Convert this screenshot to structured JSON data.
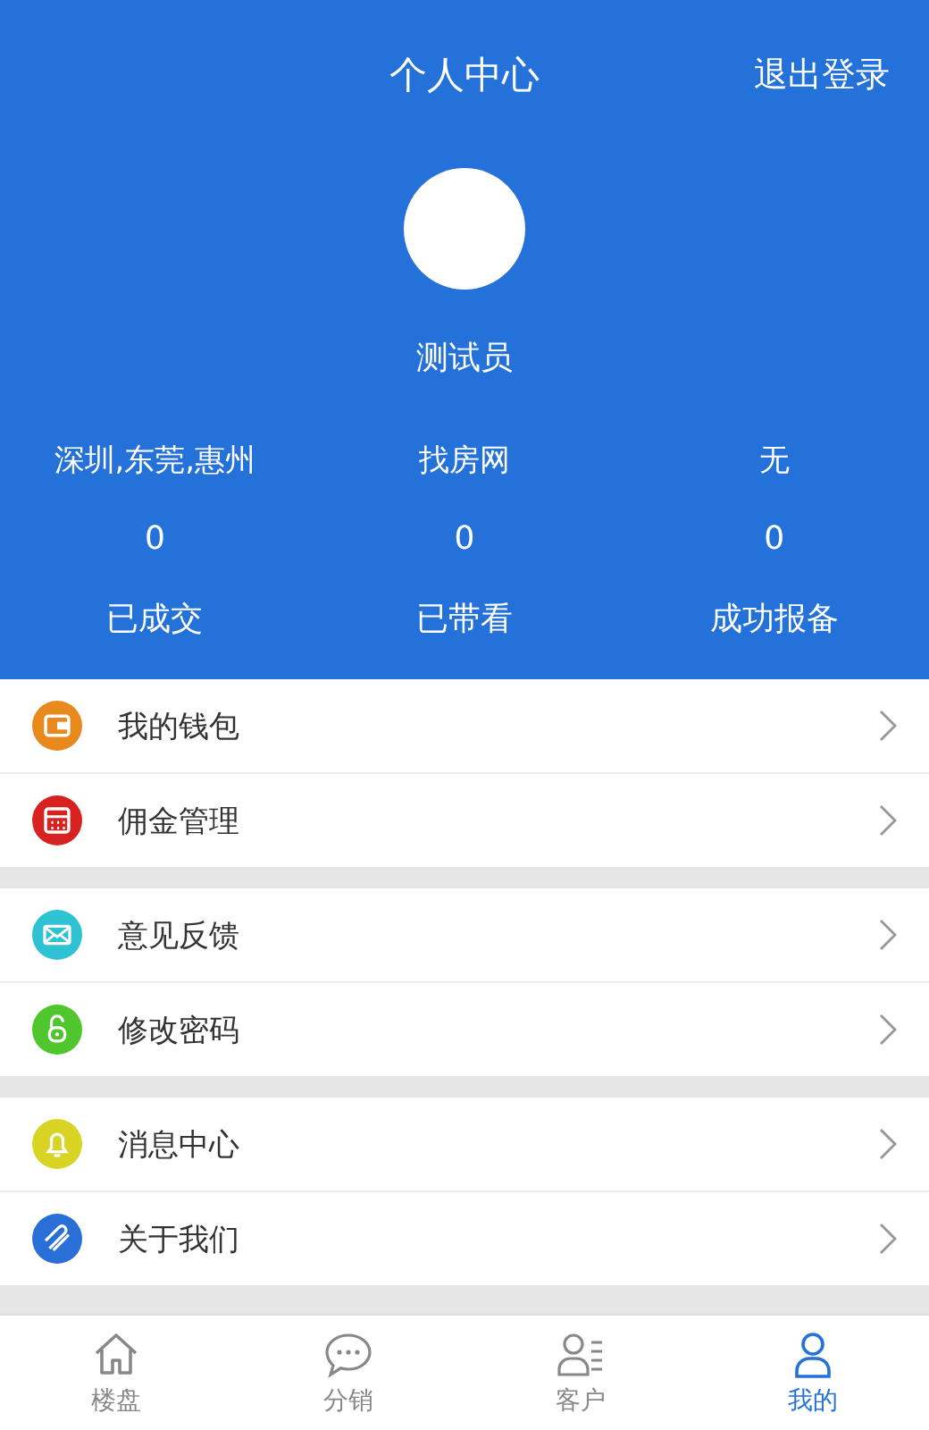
{
  "header": {
    "title": "个人中心",
    "logout": "退出登录",
    "user_name": "测试员"
  },
  "info": [
    "深圳,东莞,惠州",
    "找房网",
    "无"
  ],
  "stats": [
    {
      "value": "0",
      "label": "已成交"
    },
    {
      "value": "0",
      "label": "已带看"
    },
    {
      "value": "0",
      "label": "成功报备"
    }
  ],
  "menu_groups": [
    [
      {
        "label": "我的钱包",
        "kind": "wallet",
        "color": "#e8891e"
      },
      {
        "label": "佣金管理",
        "kind": "calendar",
        "color": "#d8221f"
      }
    ],
    [
      {
        "label": "意见反馈",
        "kind": "mail",
        "color": "#2ec3d3"
      },
      {
        "label": "修改密码",
        "kind": "lock",
        "color": "#4fc52e"
      }
    ],
    [
      {
        "label": "消息中心",
        "kind": "bell",
        "color": "#d9d324"
      },
      {
        "label": "关于我们",
        "kind": "clip",
        "color": "#2a6fd6"
      }
    ]
  ],
  "tabs": [
    {
      "label": "楼盘",
      "kind": "home",
      "selected": false
    },
    {
      "label": "分销",
      "kind": "chat",
      "selected": false
    },
    {
      "label": "客户",
      "kind": "clients",
      "selected": false
    },
    {
      "label": "我的",
      "kind": "person",
      "selected": true
    }
  ]
}
